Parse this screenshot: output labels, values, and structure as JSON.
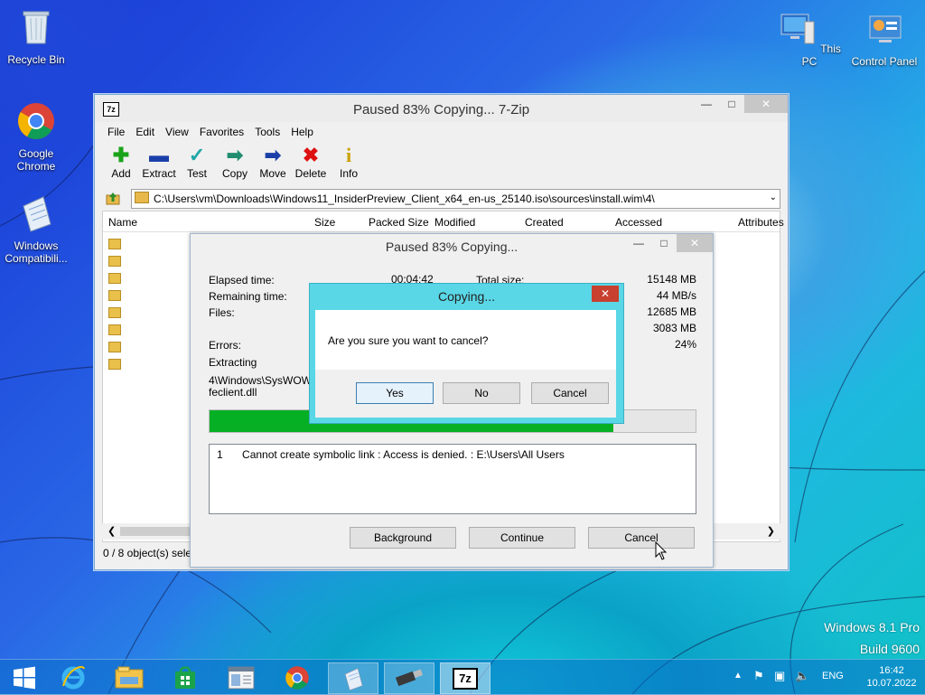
{
  "desktop_icons": [
    {
      "label": "Recycle Bin"
    },
    {
      "label": "Google Chrome"
    },
    {
      "label": "Windows Compatibili..."
    },
    {
      "label": "This PC"
    },
    {
      "label": "Control Panel"
    }
  ],
  "main_window": {
    "title": "Paused 83% Copying... 7-Zip",
    "app_icon_label": "7z",
    "menu": [
      "File",
      "Edit",
      "View",
      "Favorites",
      "Tools",
      "Help"
    ],
    "toolbar": [
      "Add",
      "Extract",
      "Test",
      "Copy",
      "Move",
      "Delete",
      "Info"
    ],
    "address": "C:\\Users\\vm\\Downloads\\Windows11_InsiderPreview_Client_x64_en-us_25140.iso\\sources\\install.wim\\4\\",
    "columns": [
      "Name",
      "Size",
      "Packed Size",
      "Modified",
      "Created",
      "Accessed",
      "Attributes"
    ],
    "status_text": "0 / 8 object(s) sele"
  },
  "progress_dialog": {
    "title": "Paused 83% Copying...",
    "elapsed_label": "Elapsed time:",
    "elapsed_value": "00:04:42",
    "remaining_label": "Remaining time:",
    "files_label": "Files:",
    "errors_label": "Errors:",
    "extracting_label": "Extracting",
    "current_path": "4\\Windows\\SysWOW6",
    "current_file": "feclient.dll",
    "total_size_label": "Total size:",
    "total_size": "15148 MB",
    "speed": "44 MB/s",
    "processed": "12685 MB",
    "compressed": "3083 MB",
    "ratio": "24%",
    "progress_fraction": 0.83,
    "log": [
      {
        "index": "1",
        "message": "Cannot create symbolic link : Access is denied. : E:\\Users\\All Users"
      }
    ],
    "buttons": {
      "background": "Background",
      "continue": "Continue",
      "cancel": "Cancel"
    }
  },
  "confirm_dialog": {
    "title": "Copying...",
    "message": "Are you sure you want to cancel?",
    "buttons": {
      "yes": "Yes",
      "no": "No",
      "cancel": "Cancel"
    }
  },
  "watermark": {
    "line1": "Windows 8.1 Pro",
    "line2": "Build 9600"
  },
  "taskbar": {
    "tray_lang": "ENG",
    "time": "16:42",
    "date": "10.07.2022"
  },
  "colors": {
    "progress": "#06b025",
    "accent": "#5ad7e6",
    "close_red": "#c8402e"
  }
}
